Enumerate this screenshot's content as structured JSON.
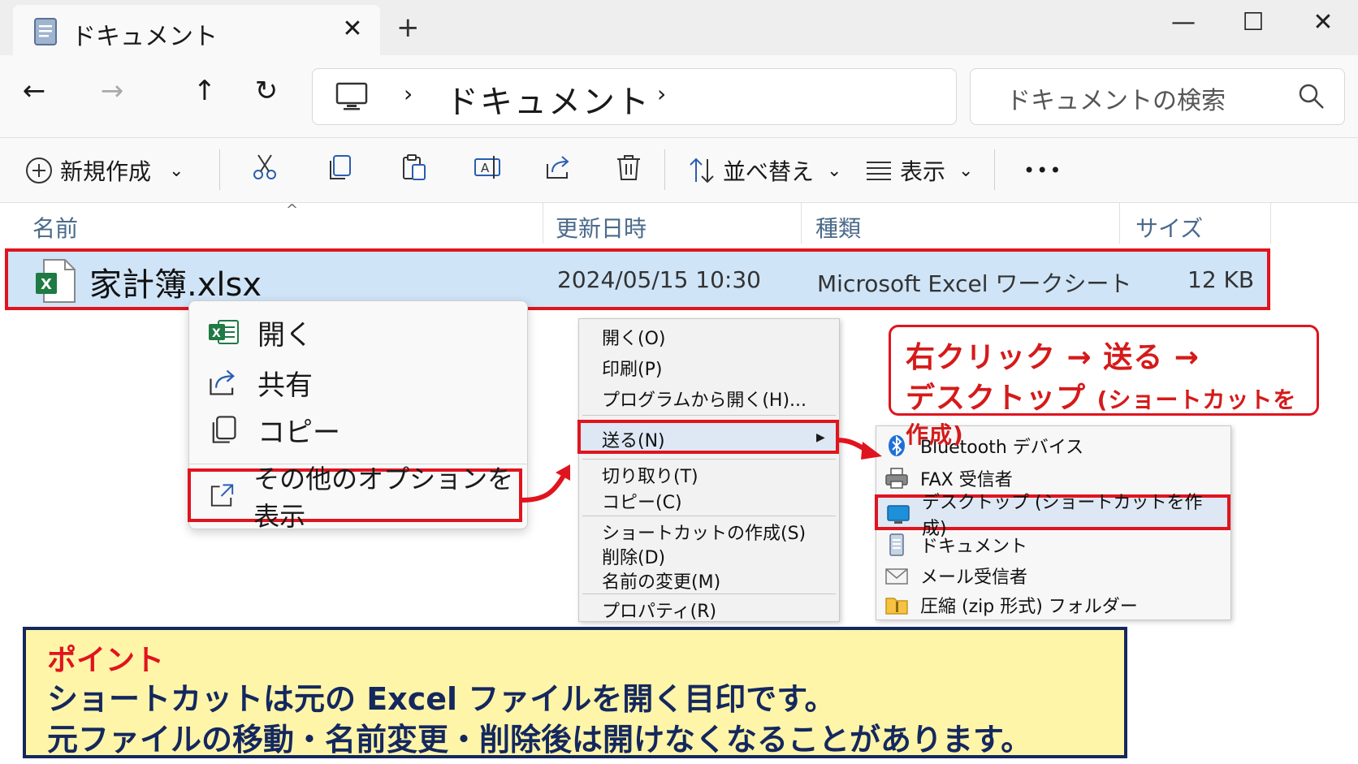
{
  "window": {
    "tab_title": "ドキュメント",
    "tab_close": "✕",
    "new_tab": "+",
    "minimize": "—",
    "maximize": "☐",
    "close": "✕"
  },
  "nav": {
    "back": "←",
    "forward": "→",
    "up": "↑",
    "refresh": "↻",
    "crumb_sep": "›",
    "crumb": "ドキュメント",
    "search_placeholder": "ドキュメントの検索"
  },
  "toolbar": {
    "new_label": "新規作成",
    "sort_label": "並べ替え",
    "view_label": "表示",
    "more_label": "•••",
    "chevron": "⌄"
  },
  "columns": {
    "name": "名前",
    "modified": "更新日時",
    "type": "種類",
    "size": "サイズ",
    "sort_indicator": "^"
  },
  "file": {
    "name": "家計簿.xlsx",
    "modified": "2024/05/15 10:30",
    "type": "Microsoft Excel ワークシート",
    "size": "12 KB"
  },
  "context_menu": {
    "open": "開く",
    "share": "共有",
    "copy": "コピー",
    "more_options": "その他のオプションを表示"
  },
  "classic_menu": {
    "open": "開く(O)",
    "print": "印刷(P)",
    "open_with": "プログラムから開く(H)...",
    "send_to": "送る(N)",
    "cut": "切り取り(T)",
    "copy": "コピー(C)",
    "create_shortcut": "ショートカットの作成(S)",
    "delete": "削除(D)",
    "rename": "名前の変更(M)",
    "properties": "プロパティ(R)",
    "submenu_arrow": "▶"
  },
  "send_to_menu": {
    "bluetooth": "Bluetooth デバイス",
    "fax": "FAX 受信者",
    "desktop": "デスクトップ (ショートカットを作成)",
    "documents": "ドキュメント",
    "mail": "メール受信者",
    "zip": "圧縮 (zip 形式) フォルダー"
  },
  "callout": {
    "line1": "右クリック → 送る →",
    "line2_main": "デスクトップ",
    "line2_small": "(ショートカットを作成)"
  },
  "point": {
    "title": "ポイント",
    "line1": "ショートカットは元の Excel ファイルを開く目印です。",
    "line2": "元ファイルの移動・名前変更・削除後は開けなくなることがあります。"
  },
  "colors": {
    "highlight_red": "#e0141e",
    "selection_blue": "#cfe4f7",
    "point_bg": "#fff5a8",
    "point_border": "#14285e"
  }
}
